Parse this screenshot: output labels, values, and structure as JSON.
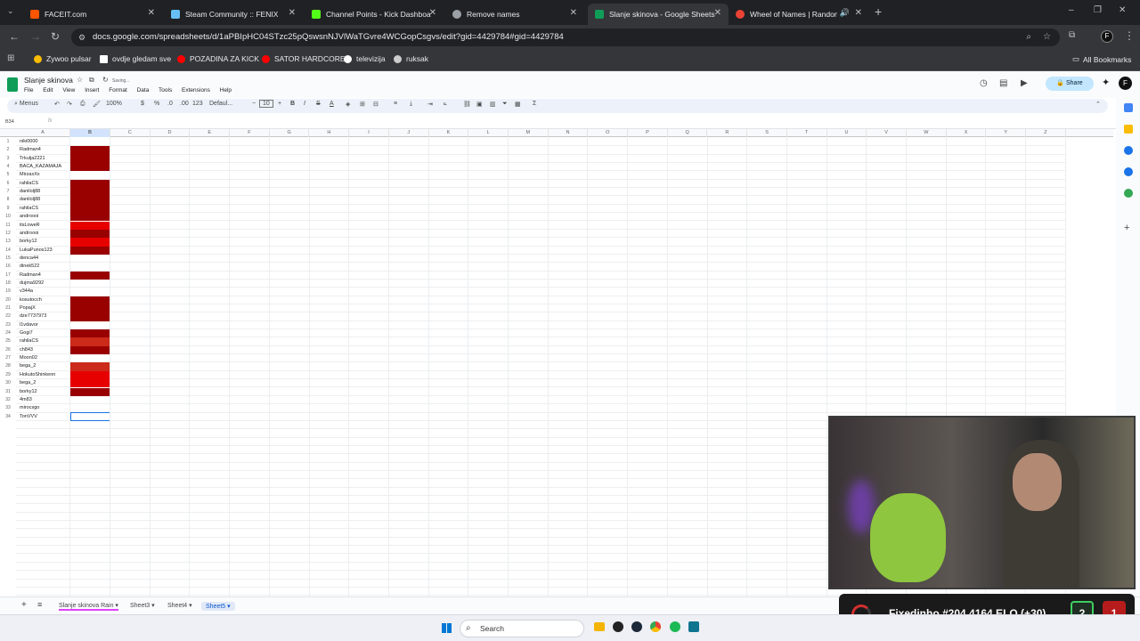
{
  "browser": {
    "tabs": [
      {
        "label": "FACEIT.com",
        "color": "#ff5500"
      },
      {
        "label": "Steam Community :: FENIX",
        "color": "#66c0f4"
      },
      {
        "label": "Channel Points - Kick Dashboa",
        "color": "#53fc18"
      },
      {
        "label": "Remove names",
        "color": "#9aa0a6"
      },
      {
        "label": "Slanje skinova - Google Sheets",
        "color": "#0f9d58"
      },
      {
        "label": "Wheel of Names | Random",
        "color": "#ea4335"
      }
    ],
    "url": "docs.google.com/spreadsheets/d/1aPBIpHC04STzc25pQswsnNJVlWaTGvre4WCGopCsgvs/edit?gid=4429784#gid=4429784",
    "bookmarks": [
      {
        "label": "Zywoo pulsar",
        "color": "#fbbc04"
      },
      {
        "label": "ovdje gledam sve",
        "color": "#ffffff"
      },
      {
        "label": "POZADINA ZA KICK",
        "color": "#ff0000"
      },
      {
        "label": "SATOR HARDCORE",
        "color": "#ff0000"
      },
      {
        "label": "televizija",
        "color": "#ffffff"
      },
      {
        "label": "ruksak",
        "color": "#cccccc"
      }
    ],
    "all_bookmarks": "All Bookmarks"
  },
  "sheets": {
    "title": "Slanje skinova",
    "status": "Saving...",
    "menu": [
      "File",
      "Edit",
      "View",
      "Insert",
      "Format",
      "Data",
      "Tools",
      "Extensions",
      "Help"
    ],
    "share_label": "Share",
    "toolbar": {
      "menus": "Menus",
      "zoom": "100%",
      "currency": "$",
      "percent": "%",
      "format_dec": ".0",
      "format_inc": ".00",
      "format_num": "123",
      "font": "Defaul...",
      "font_size": "10"
    },
    "name_box": "B34",
    "fx": "fx",
    "columns": [
      "A",
      "B",
      "C",
      "D",
      "E",
      "F",
      "G",
      "H",
      "I",
      "J",
      "K",
      "L",
      "M",
      "N",
      "O",
      "P",
      "Q",
      "R",
      "S",
      "T",
      "U",
      "V",
      "W",
      "X",
      "Y",
      "Z"
    ],
    "rows": [
      {
        "n": "1",
        "a": "niki0000",
        "b": ""
      },
      {
        "n": "2",
        "a": "Radman4",
        "b": "#990000"
      },
      {
        "n": "3",
        "a": "Trkulja2221",
        "b": "#990000"
      },
      {
        "n": "4",
        "a": "BACA_KAZAMAJA",
        "b": "#990000"
      },
      {
        "n": "5",
        "a": "MirzaxXx",
        "b": ""
      },
      {
        "n": "6",
        "a": "rahilaCS",
        "b": "#990000"
      },
      {
        "n": "7",
        "a": "danilolj88",
        "b": "#990000"
      },
      {
        "n": "8",
        "a": "danilolj88",
        "b": "#990000"
      },
      {
        "n": "9",
        "a": "rahilaCS",
        "b": "#990000"
      },
      {
        "n": "10",
        "a": "androooi",
        "b": "#990000"
      },
      {
        "n": "11",
        "a": "itsLoweR",
        "b": "#e60000"
      },
      {
        "n": "12",
        "a": "androooi",
        "b": "#990000"
      },
      {
        "n": "13",
        "a": "borky12",
        "b": "#e60000"
      },
      {
        "n": "14",
        "a": "LukaPunos123",
        "b": "#990000"
      },
      {
        "n": "15",
        "a": "denca44",
        "b": ""
      },
      {
        "n": "16",
        "a": "dinek522",
        "b": ""
      },
      {
        "n": "17",
        "a": "Radman4",
        "b": "#990000"
      },
      {
        "n": "18",
        "a": "dujma9292",
        "b": ""
      },
      {
        "n": "19",
        "a": "v344a",
        "b": ""
      },
      {
        "n": "20",
        "a": "kosutocch",
        "b": "#990000"
      },
      {
        "n": "21",
        "a": "PopajX",
        "b": "#990000"
      },
      {
        "n": "22",
        "a": "dze7737973",
        "b": "#990000"
      },
      {
        "n": "23",
        "a": "l1vdavor",
        "b": ""
      },
      {
        "n": "24",
        "a": "Gogi7",
        "b": "#990000"
      },
      {
        "n": "25",
        "a": "rahilaCS",
        "b": "#cc2a1a"
      },
      {
        "n": "26",
        "a": "ch843",
        "b": "#990000"
      },
      {
        "n": "27",
        "a": "Moon02",
        "b": ""
      },
      {
        "n": "28",
        "a": "bega_2",
        "b": "#cc2a1a"
      },
      {
        "n": "29",
        "a": "HokutoShinkenn",
        "b": "#e60000"
      },
      {
        "n": "30",
        "a": "bega_2",
        "b": "#e60000"
      },
      {
        "n": "31",
        "a": "borky12",
        "b": "#990000"
      },
      {
        "n": "32",
        "a": "4m83",
        "b": ""
      },
      {
        "n": "33",
        "a": "mirocsgo",
        "b": ""
      },
      {
        "n": "34",
        "a": "TonVVV",
        "b": ""
      }
    ],
    "sheet_tabs": [
      "Slanje skinova Rain",
      "Sheet3",
      "Sheet4",
      "Sheet5"
    ]
  },
  "taskbar": {
    "search": "Search"
  },
  "overlay": {
    "text": "Fixedinho #204 4164 ELO (+30)",
    "wins": "2",
    "losses": "1"
  }
}
